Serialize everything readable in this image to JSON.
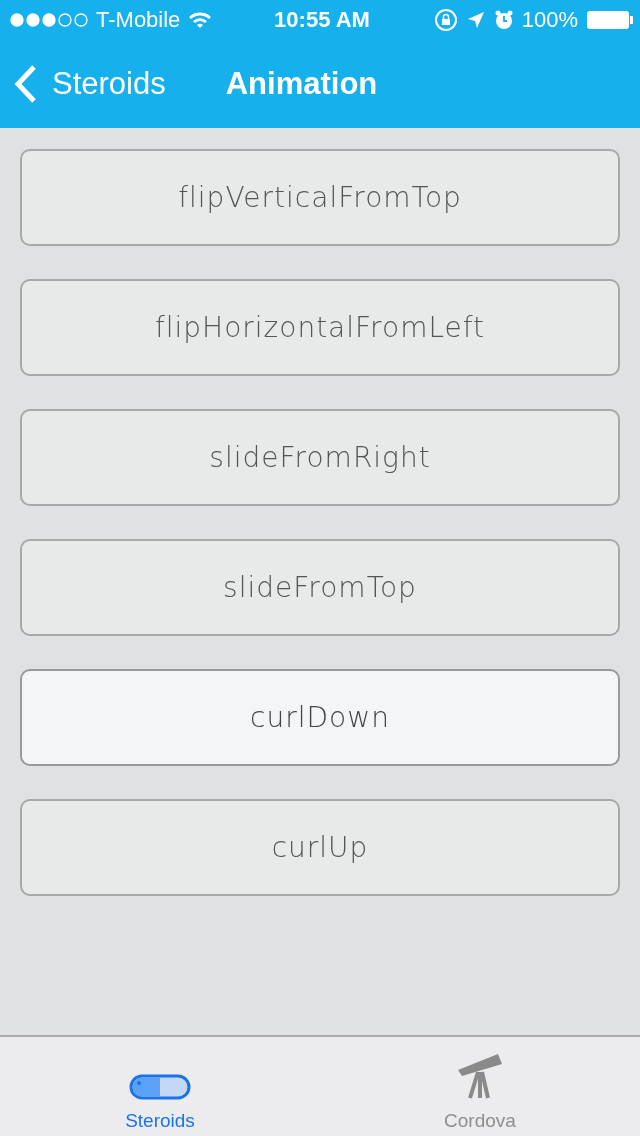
{
  "status_bar": {
    "carrier": "T-Mobile",
    "time": "10:55 AM",
    "battery": "100%"
  },
  "nav_bar": {
    "back": "Steroids",
    "title": "Animation"
  },
  "buttons": [
    {
      "label": "flipVerticalFromTop",
      "highlighted": false
    },
    {
      "label": "flipHorizontalFromLeft",
      "highlighted": false
    },
    {
      "label": "slideFromRight",
      "highlighted": false
    },
    {
      "label": "slideFromTop",
      "highlighted": false
    },
    {
      "label": "curlDown",
      "highlighted": true
    },
    {
      "label": "curlUp",
      "highlighted": false
    }
  ],
  "tab_bar": [
    {
      "label": "Steroids",
      "kind": "pill",
      "selected": true
    },
    {
      "label": "Cordova",
      "kind": "telescope",
      "selected": false
    }
  ]
}
